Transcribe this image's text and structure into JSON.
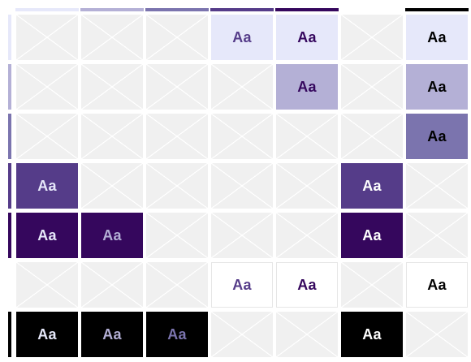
{
  "sample_text": "Aa",
  "palette": [
    "#e6e8fa",
    "#b4b0d6",
    "#7b74ae",
    "#553c89",
    "#35075d",
    "#ffffff",
    "#000000"
  ],
  "grid": [
    [
      null,
      null,
      null,
      {
        "fg": "#553c89",
        "bg": "#e6e8fa"
      },
      {
        "fg": "#35075d",
        "bg": "#e6e8fa"
      },
      null,
      {
        "fg": "#000000",
        "bg": "#e6e8fa"
      }
    ],
    [
      null,
      null,
      null,
      null,
      {
        "fg": "#35075d",
        "bg": "#b4b0d6"
      },
      null,
      {
        "fg": "#000000",
        "bg": "#b4b0d6"
      }
    ],
    [
      null,
      null,
      null,
      null,
      null,
      null,
      {
        "fg": "#000000",
        "bg": "#7b74ae"
      }
    ],
    [
      {
        "fg": "#e6e8fa",
        "bg": "#553c89"
      },
      null,
      null,
      null,
      null,
      {
        "fg": "#ffffff",
        "bg": "#553c89"
      },
      null
    ],
    [
      {
        "fg": "#e6e8fa",
        "bg": "#35075d"
      },
      {
        "fg": "#b4b0d6",
        "bg": "#35075d"
      },
      null,
      null,
      null,
      {
        "fg": "#ffffff",
        "bg": "#35075d"
      },
      null
    ],
    [
      null,
      null,
      null,
      {
        "fg": "#553c89",
        "bg": "#ffffff"
      },
      {
        "fg": "#35075d",
        "bg": "#ffffff"
      },
      null,
      {
        "fg": "#000000",
        "bg": "#ffffff"
      }
    ],
    [
      {
        "fg": "#e6e8fa",
        "bg": "#000000"
      },
      {
        "fg": "#b4b0d6",
        "bg": "#000000"
      },
      {
        "fg": "#7b74ae",
        "bg": "#000000"
      },
      null,
      null,
      {
        "fg": "#ffffff",
        "bg": "#000000"
      },
      null
    ]
  ]
}
